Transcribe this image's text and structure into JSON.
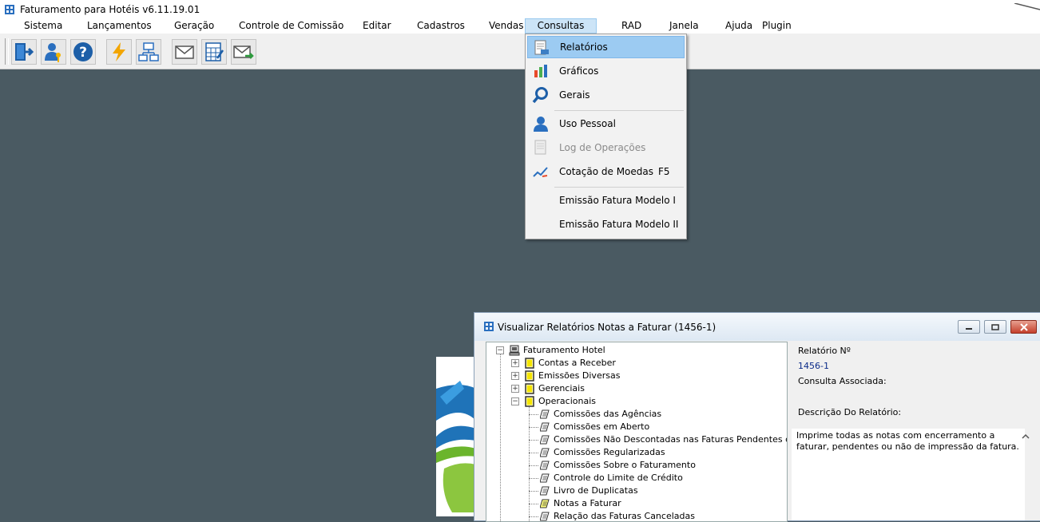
{
  "app": {
    "title": "Faturamento para Hotéis v6.11.19.01"
  },
  "menubar": [
    {
      "label": "Sistema"
    },
    {
      "label": "Lançamentos"
    },
    {
      "label": "Geração"
    },
    {
      "label": "Controle de Comissão"
    },
    {
      "label": "Editar"
    },
    {
      "label": "Cadastros"
    },
    {
      "label": "Vendas"
    },
    {
      "label": "Consultas",
      "active": true
    },
    {
      "label": "RAD"
    },
    {
      "label": "Janela"
    },
    {
      "label": "Ajuda"
    },
    {
      "label": "Plugin"
    }
  ],
  "toolbar": {
    "buttons": [
      "exit-icon",
      "user-key-icon",
      "help-icon",
      "lightning-icon",
      "network-icon",
      "mail-icon",
      "calculator-icon",
      "mail-forward-icon"
    ]
  },
  "consultas_menu": {
    "items": [
      {
        "label": "Relatórios",
        "icon": "report-icon",
        "highlight": true
      },
      {
        "label": "Gráficos",
        "icon": "bar-chart-icon"
      },
      {
        "label": "Gerais",
        "icon": "magnifier-icon"
      },
      {
        "label": "Uso Pessoal",
        "icon": "person-icon"
      },
      {
        "label": "Log de Operações",
        "icon": "log-icon",
        "disabled": true
      },
      {
        "label": "Cotação de Moedas",
        "icon": "currency-chart-icon",
        "shortcut": "F5"
      },
      {
        "label": "Emissão Fatura Modelo I"
      },
      {
        "label": "Emissão Fatura Modelo II"
      }
    ]
  },
  "report_window": {
    "title": "Visualizar Relatórios Notas a Faturar (1456-1)",
    "tree": {
      "root": "Faturamento Hotel",
      "folders": [
        "Contas a Receber",
        "Emissões Diversas",
        "Gerenciais",
        "Operacionais"
      ],
      "reports": [
        "Comissões das Agências",
        "Comissões em Aberto",
        "Comissões Não Descontadas nas Faturas Pendentes de N",
        "Comissões Regularizadas",
        "Comissões Sobre o Faturamento",
        "Controle do Limite de Crédito",
        "Livro de Duplicatas",
        "Notas a Faturar",
        "Relação das Faturas Canceladas"
      ]
    },
    "info": {
      "report_number_label": "Relatório Nº",
      "report_number": "1456-1",
      "query_label": "Consulta Associada:",
      "description_label": "Descrição Do Relatório:",
      "description": "Imprime todas as notas com encerramento a faturar, pendentes ou não de impressão da fatura."
    }
  },
  "colors": {
    "workspace": "#4a5a62",
    "menu_highlight": "#9ccbf2",
    "report_number": "#0a2a88"
  }
}
